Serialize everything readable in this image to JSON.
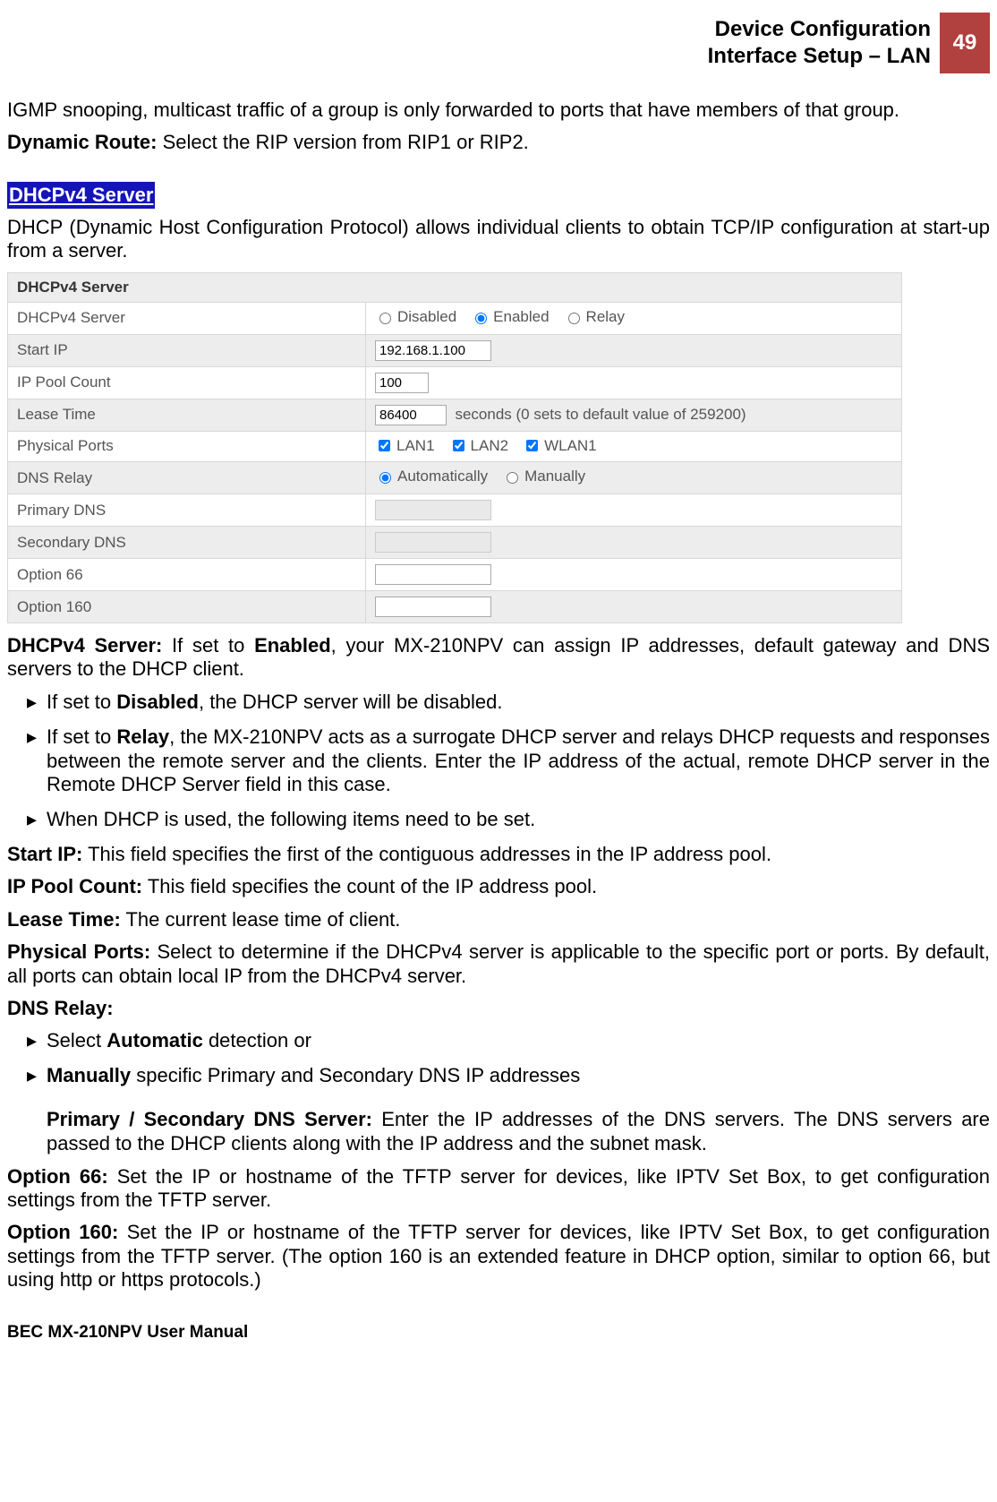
{
  "header": {
    "title_line1": "Device Configuration",
    "title_line2": "Interface Setup – LAN",
    "page_number": "49"
  },
  "intro": {
    "igmp_text": "IGMP snooping, multicast traffic of a group is only forwarded to ports that have members of that group.",
    "dynamic_route_label": "Dynamic Route:",
    "dynamic_route_text": " Select the RIP version from RIP1 or RIP2."
  },
  "dhcp_section": {
    "heading": "DHCPv4 Server",
    "desc": "DHCP (Dynamic Host Configuration Protocol) allows individual clients to obtain TCP/IP configuration at start-up from a server."
  },
  "table": {
    "title": "DHCPv4 Server",
    "rows": {
      "server_label": "DHCPv4 Server",
      "server_opts": {
        "disabled": "Disabled",
        "enabled": "Enabled",
        "relay": "Relay"
      },
      "start_ip_label": "Start IP",
      "start_ip_value": "192.168.1.100",
      "pool_label": "IP Pool Count",
      "pool_value": "100",
      "lease_label": "Lease Time",
      "lease_value": "86400",
      "lease_suffix": "seconds   (0 sets to default value of 259200)",
      "ports_label": "Physical Ports",
      "ports": {
        "lan1": "LAN1",
        "lan2": "LAN2",
        "wlan1": "WLAN1"
      },
      "dnsrelay_label": "DNS Relay",
      "dnsrelay_opts": {
        "auto": "Automatically",
        "manual": "Manually"
      },
      "pdns_label": "Primary DNS",
      "sdns_label": "Secondary DNS",
      "opt66_label": "Option 66",
      "opt160_label": "Option 160"
    }
  },
  "body": {
    "dhcpv4_server_label": "DHCPv4 Server:",
    "dhcpv4_server_text1": " If set to ",
    "dhcpv4_server_bold": "Enabled",
    "dhcpv4_server_text2": ", your MX-210NPV can assign IP addresses, default gateway and DNS servers to the DHCP client.",
    "bullets1": [
      {
        "pre": "If set to ",
        "bold": "Disabled",
        "post": ", the DHCP server will be disabled."
      },
      {
        "pre": "If set to ",
        "bold": "Relay",
        "post": ", the MX-210NPV acts as a surrogate DHCP server and relays DHCP requests and responses between the remote server and the clients. Enter the IP address of the actual, remote DHCP server in the Remote DHCP Server field in this case."
      },
      {
        "pre": "When DHCP is used, the following items need to be set.",
        "bold": "",
        "post": ""
      }
    ],
    "start_ip_label": "Start IP:",
    "start_ip_text": " This field specifies the first of the contiguous addresses in the IP address pool.",
    "pool_label": "IP Pool Count:",
    "pool_text": " This field specifies the count of the IP address pool.",
    "lease_label": "Lease Time:",
    "lease_text": " The current lease time of client.",
    "ports_label": "Physical Ports:",
    "ports_text": " Select to determine if the DHCPv4 server is applicable to the specific port or ports. By default, all ports can obtain local IP from the DHCPv4 server.",
    "dnsrelay_label": "DNS Relay:",
    "bullets2": [
      {
        "pre": "Select ",
        "bold": "Automatic",
        "post": " detection or"
      },
      {
        "pre": "",
        "bold": "Manually",
        "post": " specific Primary and Secondary DNS IP addresses"
      }
    ],
    "dns_sub_label": "Primary / Secondary DNS Server:",
    "dns_sub_text": " Enter the IP addresses of the DNS servers. The DNS servers are passed to the DHCP clients along with the IP address and the subnet mask.",
    "opt66_label": "Option 66:",
    "opt66_text": " Set the IP or hostname of the TFTP server for devices, like IPTV Set Box, to get configuration settings from the TFTP server.",
    "opt160_label": "Option 160:",
    "opt160_text": " Set the IP or hostname of the TFTP server for devices, like IPTV Set Box, to get configuration settings from the TFTP server. (The option 160 is an extended feature in DHCP option, similar to option 66, but using http or https protocols.)"
  },
  "footer": "BEC MX-210NPV User Manual"
}
